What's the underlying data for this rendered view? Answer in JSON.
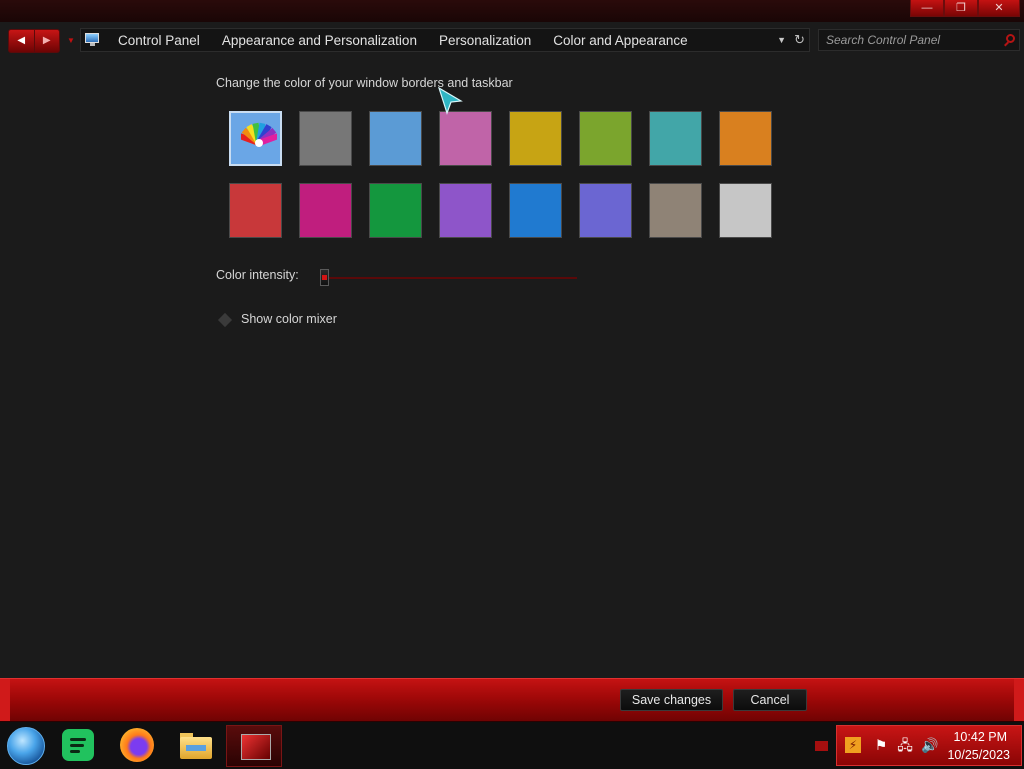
{
  "window": {
    "minimize_glyph": "—",
    "maximize_glyph": "❐",
    "close_glyph": "✕"
  },
  "address_bar": {
    "back_glyph": "◀",
    "forward_glyph": "▶",
    "recent_glyph": "▼",
    "breadcrumbs": [
      "Control Panel",
      "Appearance and Personalization",
      "Personalization",
      "Color and Appearance"
    ],
    "dropdown_glyph": "▼",
    "refresh_glyph": "↻"
  },
  "search": {
    "placeholder": "Search Control Panel"
  },
  "main": {
    "heading": "Change the color of your window borders and taskbar",
    "swatches_row1": [
      "custom",
      "#777777",
      "#5b9bd5",
      "#c064a8",
      "#c7a414",
      "#7ba52d",
      "#42a6a8",
      "#d9801f"
    ],
    "swatches_row2": [
      "#c8383a",
      "#c01e7e",
      "#14973e",
      "#8e55c9",
      "#207ad0",
      "#6b66d2",
      "#8f8376",
      "#c6c6c6"
    ],
    "selected_index": 0,
    "intensity_label": "Color intensity:",
    "intensity_value": 0.0,
    "mixer_label": "Show color mixer"
  },
  "command_bar": {
    "save_label": "Save changes",
    "cancel_label": "Cancel"
  },
  "taskbar": {
    "tray_time": "10:42 PM",
    "tray_date": "10/25/2023",
    "lightning_glyph": "⚡",
    "flag_glyph": "⚑",
    "network_glyph": "🖧",
    "volume_glyph": "🔊"
  },
  "colors": {
    "accent": "#b00d0d",
    "background": "#1b1b1b"
  }
}
